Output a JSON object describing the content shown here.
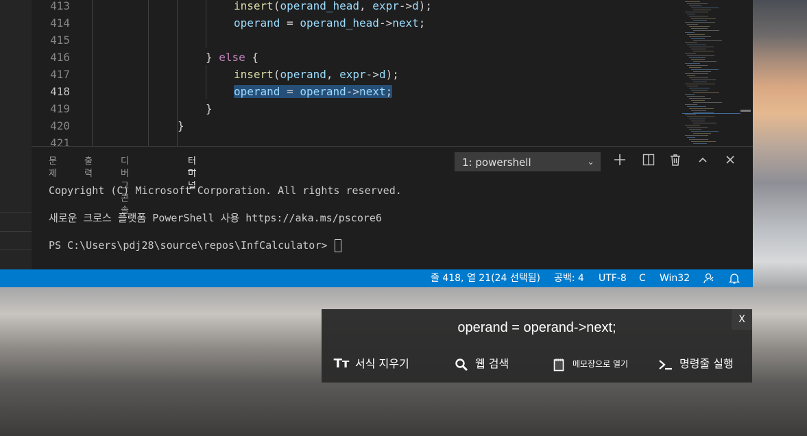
{
  "editor": {
    "lines": [
      {
        "num": "413",
        "indent": 0,
        "tokens": [
          [
            "fn",
            "insert"
          ],
          [
            "punc",
            "("
          ],
          [
            "var",
            "operand_head"
          ],
          [
            "punc",
            ", "
          ],
          [
            "var",
            "expr"
          ],
          [
            "punc",
            "->"
          ],
          [
            "var",
            "d"
          ],
          [
            "punc",
            ");"
          ]
        ]
      },
      {
        "num": "414",
        "indent": 0,
        "tokens": [
          [
            "var",
            "operand"
          ],
          [
            "punc",
            " = "
          ],
          [
            "var",
            "operand_head"
          ],
          [
            "punc",
            "->"
          ],
          [
            "var",
            "next"
          ],
          [
            "punc",
            ";"
          ]
        ]
      },
      {
        "num": "415",
        "indent": 0,
        "tokens": []
      },
      {
        "num": "416",
        "indent": -1,
        "tokens": [
          [
            "punc",
            "} "
          ],
          [
            "kw",
            "else"
          ],
          [
            "punc",
            " {"
          ]
        ]
      },
      {
        "num": "417",
        "indent": 0,
        "tokens": [
          [
            "fn",
            "insert"
          ],
          [
            "punc",
            "("
          ],
          [
            "var",
            "operand"
          ],
          [
            "punc",
            ", "
          ],
          [
            "var",
            "expr"
          ],
          [
            "punc",
            "->"
          ],
          [
            "var",
            "d"
          ],
          [
            "punc",
            ");"
          ]
        ]
      },
      {
        "num": "418",
        "indent": 0,
        "active": true,
        "tokens": [
          [
            "var",
            "operand"
          ],
          [
            "punc",
            " = "
          ],
          [
            "var",
            "operand"
          ],
          [
            "punc",
            "->"
          ],
          [
            "var",
            "next"
          ],
          [
            "punc",
            ";"
          ]
        ]
      },
      {
        "num": "419",
        "indent": -1,
        "tokens": [
          [
            "punc",
            "}"
          ]
        ]
      },
      {
        "num": "420",
        "indent": -2,
        "tokens": [
          [
            "punc",
            "}"
          ]
        ]
      },
      {
        "num": "421",
        "indent": 0,
        "tokens": []
      }
    ]
  },
  "panel": {
    "tabs": [
      "문제",
      "출력",
      "디버그 콘솔",
      "터미널"
    ],
    "active_tab": 3,
    "terminal_select": "1: powershell",
    "icons": [
      "plus-icon",
      "split-icon",
      "trash-icon",
      "chevron-up-icon",
      "close-icon"
    ],
    "terminal_lines": [
      "Copyright (C) Microsoft Corporation. All rights reserved.",
      "새로운 크로스 플랫폼 PowerShell 사용 https://aka.ms/pscore6",
      "PS C:\\Users\\pdj28\\source\\repos\\InfCalculator> "
    ]
  },
  "status_bar": {
    "position": "줄 418, 열 21(24 선택됨)",
    "spaces": "공백: 4",
    "encoding": "UTF-8",
    "language": "C",
    "platform": "Win32",
    "icons": [
      "feedback-icon",
      "bell-icon"
    ],
    "color": "#007acc"
  },
  "clipboard_popup": {
    "close_label": "X",
    "text": "operand = operand->next;",
    "actions": [
      {
        "icon": "clear-format-icon",
        "label": "서식 지우기"
      },
      {
        "icon": "search-icon",
        "label": "웹 검색"
      },
      {
        "icon": "notepad-icon",
        "label": "메모장으로 열기"
      },
      {
        "icon": "terminal-icon",
        "label": "명령줄 실행"
      }
    ]
  }
}
